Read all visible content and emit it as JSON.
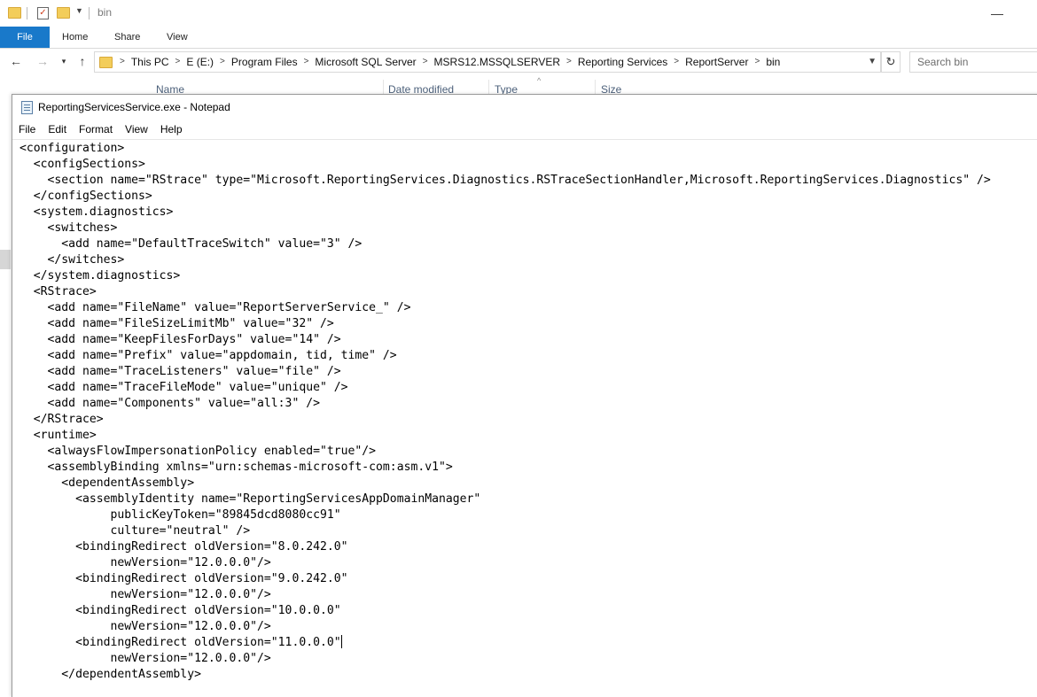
{
  "explorer": {
    "window_title": "bin",
    "ribbon_tabs": [
      "File",
      "Home",
      "Share",
      "View"
    ],
    "breadcrumbs": [
      "This PC",
      "E (E:)",
      "Program Files",
      "Microsoft SQL Server",
      "MSRS12.MSSQLSERVER",
      "Reporting Services",
      "ReportServer",
      "bin"
    ],
    "search_placeholder": "Search bin",
    "columns": [
      "Name",
      "Date modified",
      "Type",
      "Size"
    ],
    "accent_color": "#1979ca"
  },
  "notepad": {
    "title": "ReportingServicesService.exe - Notepad",
    "menu": [
      "File",
      "Edit",
      "Format",
      "View",
      "Help"
    ],
    "lines": [
      "<configuration>",
      "  <configSections>",
      "    <section name=\"RStrace\" type=\"Microsoft.ReportingServices.Diagnostics.RSTraceSectionHandler,Microsoft.ReportingServices.Diagnostics\" />",
      "  </configSections>",
      "  <system.diagnostics>",
      "    <switches>",
      "      <add name=\"DefaultTraceSwitch\" value=\"3\" />",
      "    </switches>",
      "  </system.diagnostics>",
      "  <RStrace>",
      "    <add name=\"FileName\" value=\"ReportServerService_\" />",
      "    <add name=\"FileSizeLimitMb\" value=\"32\" />",
      "    <add name=\"KeepFilesForDays\" value=\"14\" />",
      "    <add name=\"Prefix\" value=\"appdomain, tid, time\" />",
      "    <add name=\"TraceListeners\" value=\"file\" />",
      "    <add name=\"TraceFileMode\" value=\"unique\" />",
      "    <add name=\"Components\" value=\"all:3\" />",
      "  </RStrace>",
      "  <runtime>",
      "    <alwaysFlowImpersonationPolicy enabled=\"true\"/>",
      "    <assemblyBinding xmlns=\"urn:schemas-microsoft-com:asm.v1\">",
      "      <dependentAssembly>",
      "        <assemblyIdentity name=\"ReportingServicesAppDomainManager\"",
      "             publicKeyToken=\"89845dcd8080cc91\"",
      "             culture=\"neutral\" />",
      "        <bindingRedirect oldVersion=\"8.0.242.0\"",
      "             newVersion=\"12.0.0.0\"/>",
      "        <bindingRedirect oldVersion=\"9.0.242.0\"",
      "             newVersion=\"12.0.0.0\"/>",
      "        <bindingRedirect oldVersion=\"10.0.0.0\"",
      "             newVersion=\"12.0.0.0\"/>",
      "        <bindingRedirect oldVersion=\"11.0.0.0\"",
      "             newVersion=\"12.0.0.0\"/>",
      "      </dependentAssembly>"
    ],
    "caret_line": 31
  }
}
